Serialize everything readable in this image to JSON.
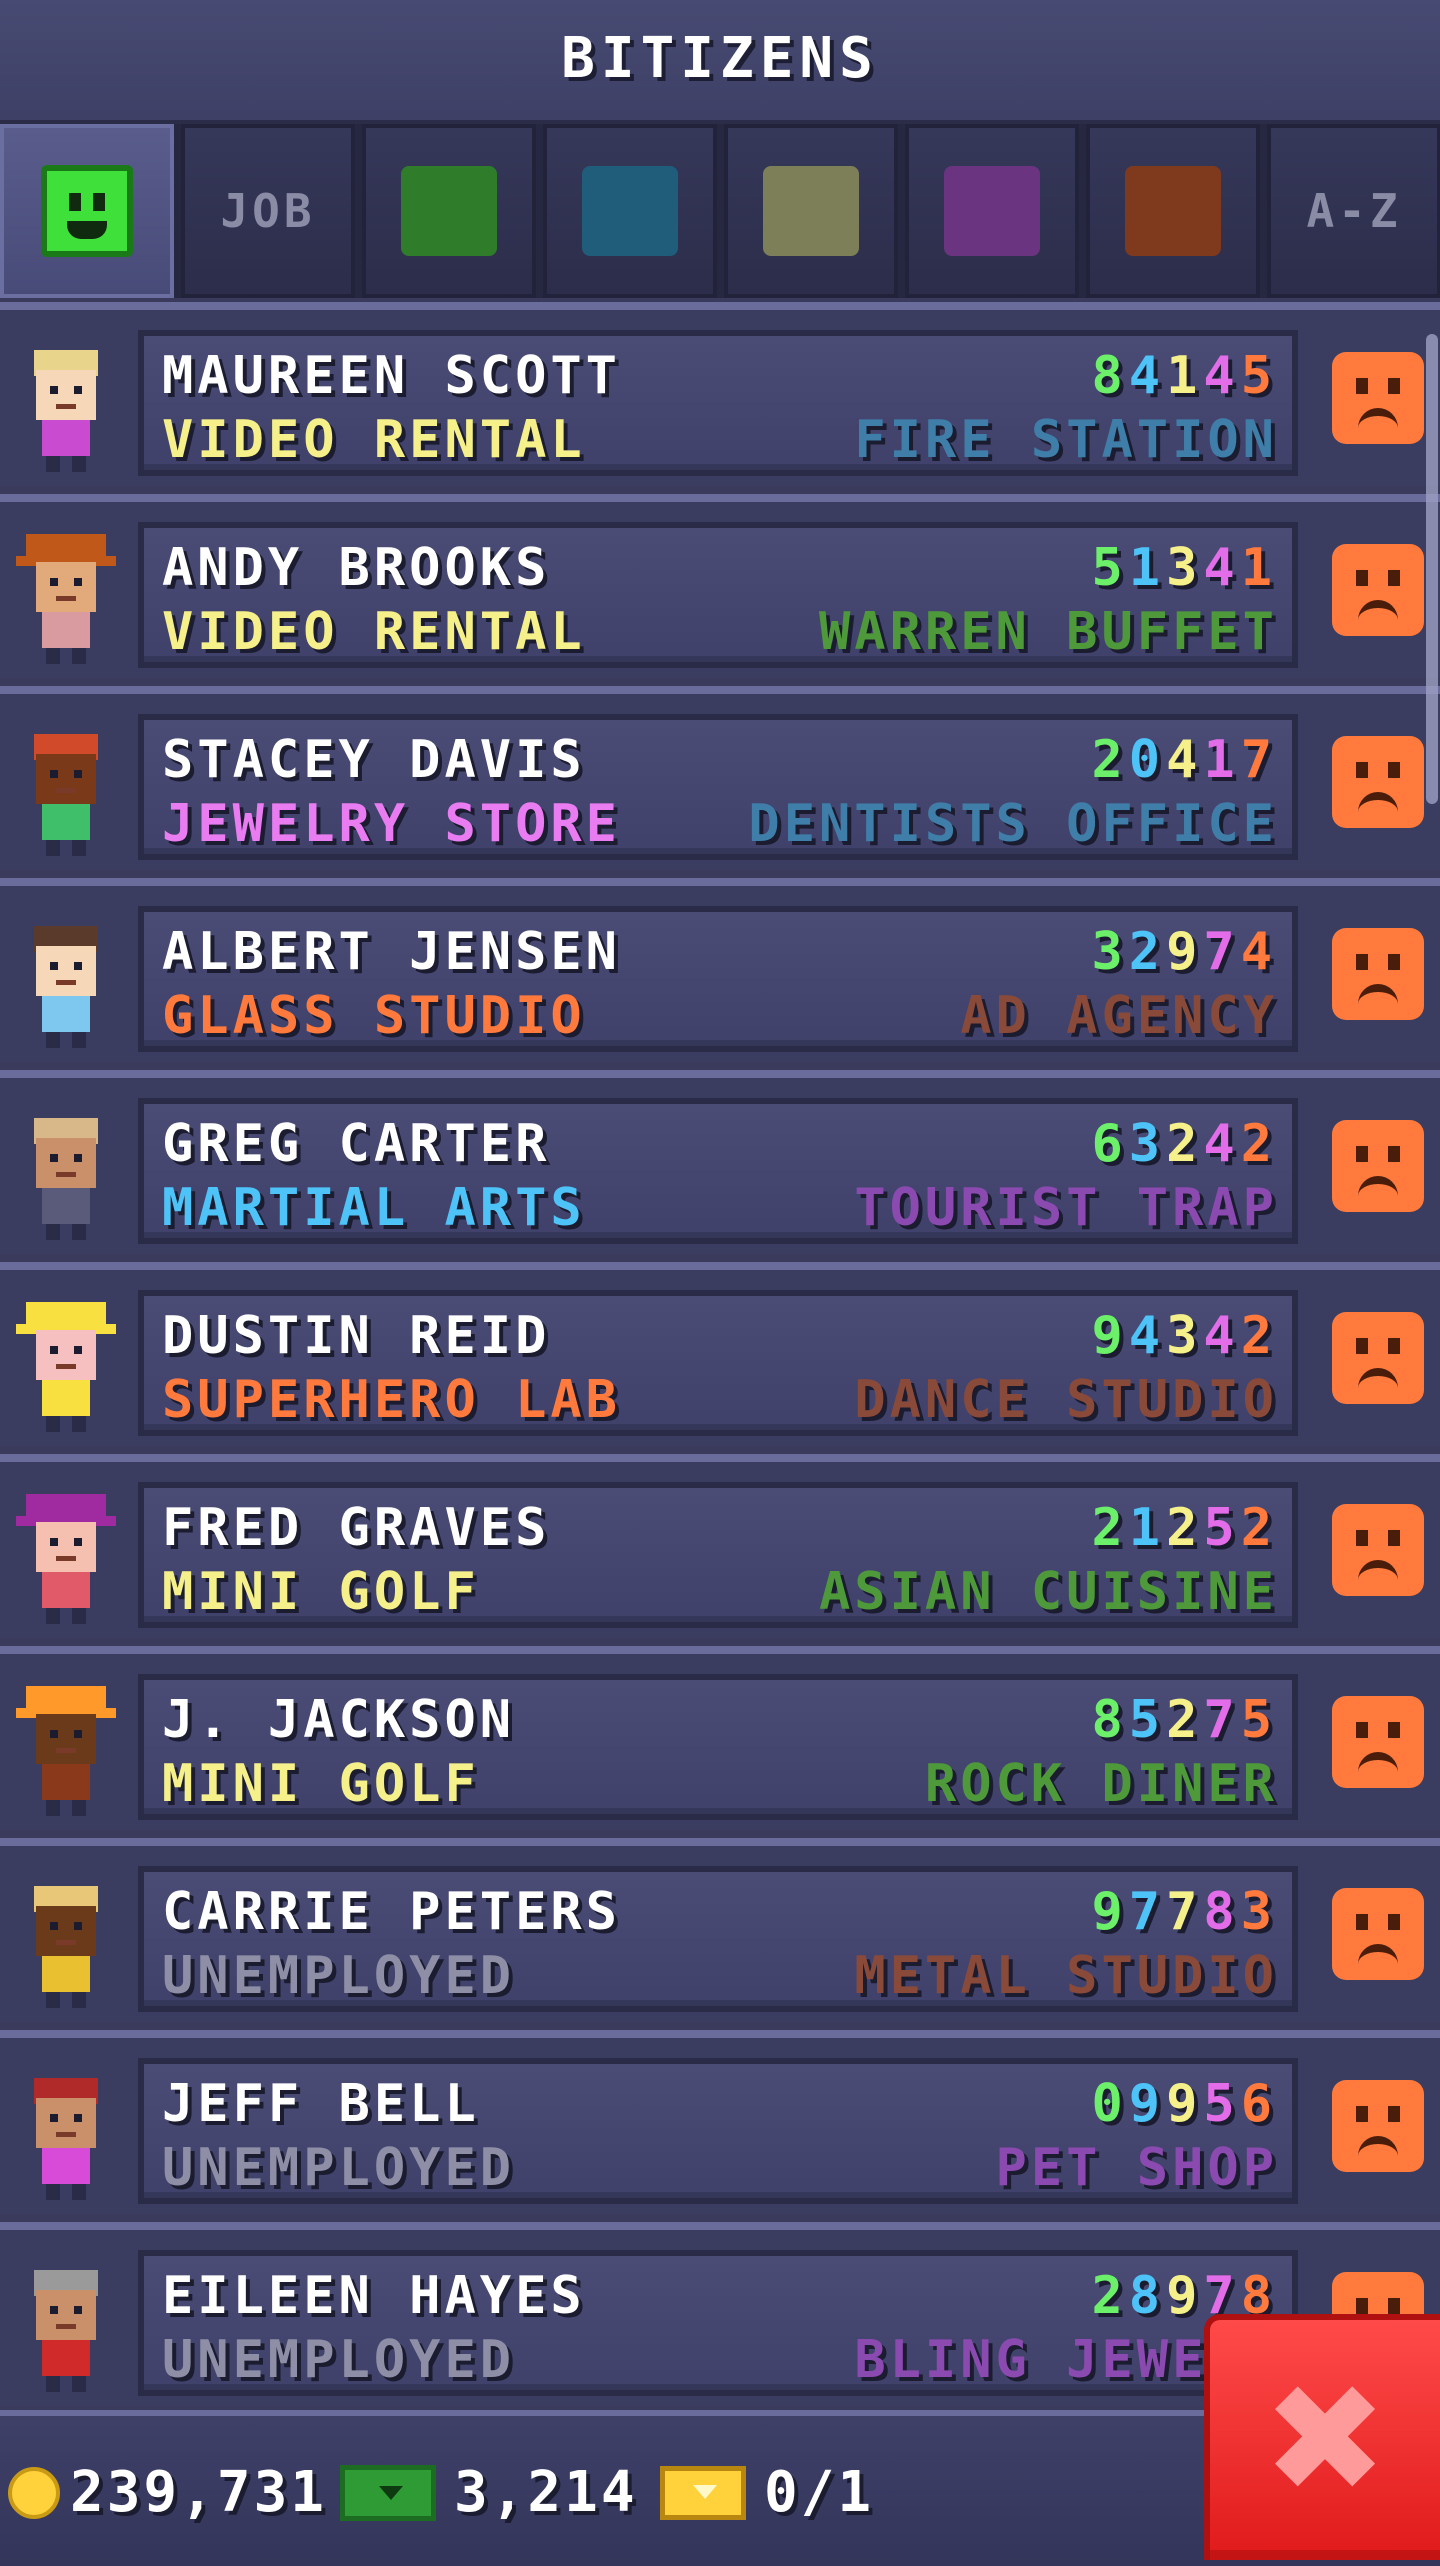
{
  "header": {
    "title": "BITIZENS"
  },
  "tabs": [
    {
      "type": "smiley",
      "name": "tab-mood",
      "active": true
    },
    {
      "type": "text",
      "name": "tab-job",
      "label": "JOB"
    },
    {
      "type": "color",
      "name": "tab-green",
      "color": "#2f7d2a"
    },
    {
      "type": "color",
      "name": "tab-blue",
      "color": "#1f5d7a"
    },
    {
      "type": "color",
      "name": "tab-olive",
      "color": "#7d7f58"
    },
    {
      "type": "color",
      "name": "tab-purple",
      "color": "#6a3481"
    },
    {
      "type": "color",
      "name": "tab-brown",
      "color": "#7f3a1e"
    },
    {
      "type": "text",
      "name": "tab-a-z",
      "label": "A-Z"
    }
  ],
  "bitizens": [
    {
      "name": "MAUREEN SCOTT",
      "job": "VIDEO RENTAL",
      "job_color": "#f5f08a",
      "dream": "FIRE STATION",
      "dream_color": "#3f7ea8",
      "skills": [
        "8",
        "4",
        "1",
        "4",
        "5"
      ],
      "skin": "#f6d8b8",
      "hair": "#e8d48a",
      "shirt": "#c94bd0",
      "hat": null
    },
    {
      "name": "ANDY BROOKS",
      "job": "VIDEO RENTAL",
      "job_color": "#f5f08a",
      "dream": "WARREN BUFFET",
      "dream_color": "#4e9a3a",
      "skills": [
        "5",
        "1",
        "3",
        "4",
        "1"
      ],
      "skin": "#e2a97a",
      "hair": "#b5540f",
      "shirt": "#d99aa0",
      "hat": "#c0581a"
    },
    {
      "name": "STACEY DAVIS",
      "job": "JEWELRY STORE",
      "job_color": "#e87cf0",
      "dream": "DENTISTS OFFICE",
      "dream_color": "#3f7ea8",
      "skills": [
        "2",
        "0",
        "4",
        "1",
        "7"
      ],
      "skin": "#7a3a1a",
      "hair": "#d14a2a",
      "shirt": "#3fbf6a",
      "hat": null
    },
    {
      "name": "ALBERT JENSEN",
      "job": "GLASS STUDIO",
      "job_color": "#ff7a3c",
      "dream": "AD AGENCY",
      "dream_color": "#8a4a3a",
      "skills": [
        "3",
        "2",
        "9",
        "7",
        "4"
      ],
      "skin": "#f6d8b8",
      "hair": "#5a3a2a",
      "shirt": "#7ec8f0",
      "hat": null
    },
    {
      "name": "GREG CARTER",
      "job": "MARTIAL ARTS",
      "job_color": "#4ec3f7",
      "dream": "TOURIST TRAP",
      "dream_color": "#8a4ab0",
      "skills": [
        "6",
        "3",
        "2",
        "4",
        "2"
      ],
      "skin": "#c9906a",
      "hair": "#d8b888",
      "shirt": "#5a5a7a",
      "hat": null
    },
    {
      "name": "DUSTIN REID",
      "job": "SUPERHERO LAB",
      "job_color": "#ff7a3c",
      "dream": "DANCE STUDIO",
      "dream_color": "#8a4a3a",
      "skills": [
        "9",
        "4",
        "3",
        "4",
        "2"
      ],
      "skin": "#f6c0c0",
      "hair": "#f8e040",
      "shirt": "#f8e040",
      "hat": "#f8e040"
    },
    {
      "name": "FRED GRAVES",
      "job": "MINI GOLF",
      "job_color": "#f5f08a",
      "dream": "ASIAN CUISINE",
      "dream_color": "#4e9a3a",
      "skills": [
        "2",
        "1",
        "2",
        "5",
        "2"
      ],
      "skin": "#f6c0b0",
      "hair": "#8a2a8a",
      "shirt": "#e05a6a",
      "hat": "#a02aa0"
    },
    {
      "name": "J. JACKSON",
      "job": "MINI GOLF",
      "job_color": "#f5f08a",
      "dream": "ROCK DINER",
      "dream_color": "#4e9a3a",
      "skills": [
        "8",
        "5",
        "2",
        "7",
        "5"
      ],
      "skin": "#6a3a1a",
      "hair": "#ff9a2a",
      "shirt": "#8a3a1a",
      "hat": "#ff9a2a"
    },
    {
      "name": "CARRIE PETERS",
      "job": "UNEMPLOYED",
      "job_color": "#8e8fa6",
      "dream": "METAL STUDIO",
      "dream_color": "#8a4a3a",
      "skills": [
        "9",
        "7",
        "7",
        "8",
        "3"
      ],
      "skin": "#6a3a1a",
      "hair": "#e8c878",
      "shirt": "#e8c030",
      "hat": null
    },
    {
      "name": "JEFF BELL",
      "job": "UNEMPLOYED",
      "job_color": "#8e8fa6",
      "dream": "PET SHOP",
      "dream_color": "#8a4ab0",
      "skills": [
        "0",
        "9",
        "9",
        "5",
        "6"
      ],
      "skin": "#c9906a",
      "hair": "#b02a2a",
      "shirt": "#d84ad8",
      "hat": null
    },
    {
      "name": "EILEEN HAYES",
      "job": "UNEMPLOYED",
      "job_color": "#8e8fa6",
      "dream": "BLING JEWELE",
      "dream_color": "#8a4ab0",
      "skills": [
        "2",
        "8",
        "9",
        "7",
        "8"
      ],
      "skin": "#c9906a",
      "hair": "#9a9a9a",
      "shirt": "#d02a2a",
      "hat": null
    }
  ],
  "footer": {
    "coins": "239,731",
    "bux": "3,214",
    "tickets": "0/1"
  }
}
